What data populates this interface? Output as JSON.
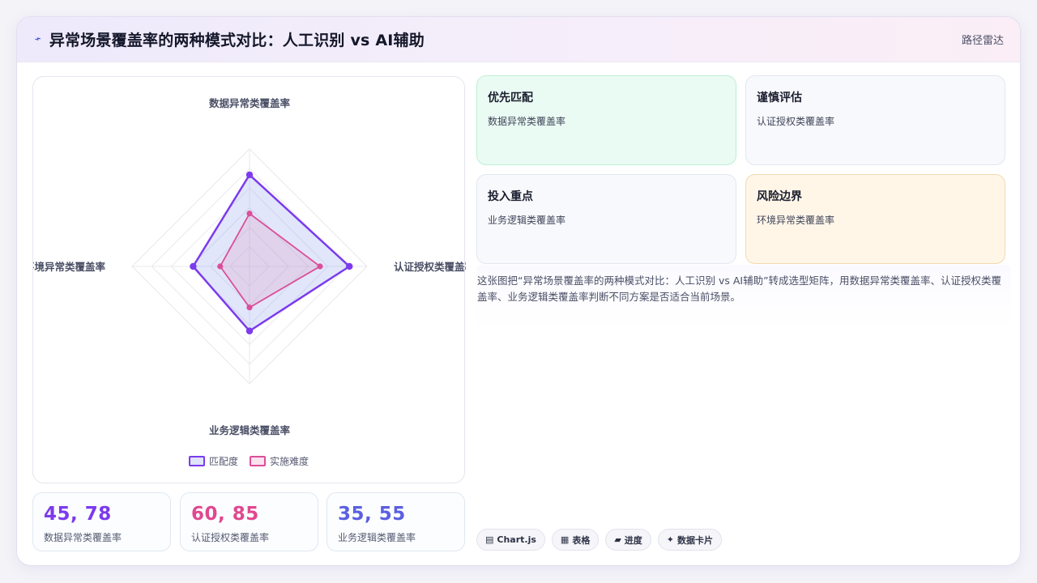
{
  "header": {
    "icon": "sparkle-icon",
    "title": "异常场景覆盖率的两种模式对比：人工识别 vs AI辅助",
    "link": "路径雷达"
  },
  "chart_data": {
    "type": "radar",
    "axes": [
      "数据异常类覆盖率",
      "认证授权类覆盖率",
      "业务逻辑类覆盖率",
      "环境异常类覆盖率"
    ],
    "series": [
      {
        "name": "匹配度",
        "values": [
          78,
          85,
          55,
          48
        ],
        "color": "#7c3aed"
      },
      {
        "name": "实施难度",
        "values": [
          45,
          60,
          35,
          25
        ],
        "color": "#db4f9a"
      }
    ],
    "range": [
      0,
      100
    ],
    "grid_levels": 6,
    "legend_position": "bottom"
  },
  "stats": [
    {
      "value": "45, 78",
      "label": "数据异常类覆盖率",
      "color": "#7c3aed"
    },
    {
      "value": "60, 85",
      "label": "认证授权类覆盖率",
      "color": "#e0488f"
    },
    {
      "value": "35, 55",
      "label": "业务逻辑类覆盖率",
      "color": "#5b5fe0"
    }
  ],
  "cards": [
    {
      "title": "优先匹配",
      "sub": "数据异常类覆盖率",
      "bg": "#eafbf3",
      "border": "#bfeed7"
    },
    {
      "title": "谨慎评估",
      "sub": "认证授权类覆盖率",
      "bg": "#f7f9fc",
      "border": "#e2e6f0"
    },
    {
      "title": "投入重点",
      "sub": "业务逻辑类覆盖率",
      "bg": "#f7f9fc",
      "border": "#e2e6f0"
    },
    {
      "title": "风险边界",
      "sub": "环境异常类覆盖率",
      "bg": "#fff6e8",
      "border": "#f4d9ae"
    }
  ],
  "description": "这张图把“异常场景覆盖率的两种模式对比：人工识别 vs AI辅助”转成选型矩阵，用数据异常类覆盖率、认证授权类覆盖率、业务逻辑类覆盖率判断不同方案是否适合当前场景。",
  "tags": [
    {
      "icon": "chart-icon",
      "glyph": "▤",
      "label": "Chart.js"
    },
    {
      "icon": "table-icon",
      "glyph": "▦",
      "label": "表格"
    },
    {
      "icon": "progress-icon",
      "glyph": "▰",
      "label": "进度"
    },
    {
      "icon": "card-icon",
      "glyph": "✦",
      "label": "数据卡片"
    }
  ]
}
